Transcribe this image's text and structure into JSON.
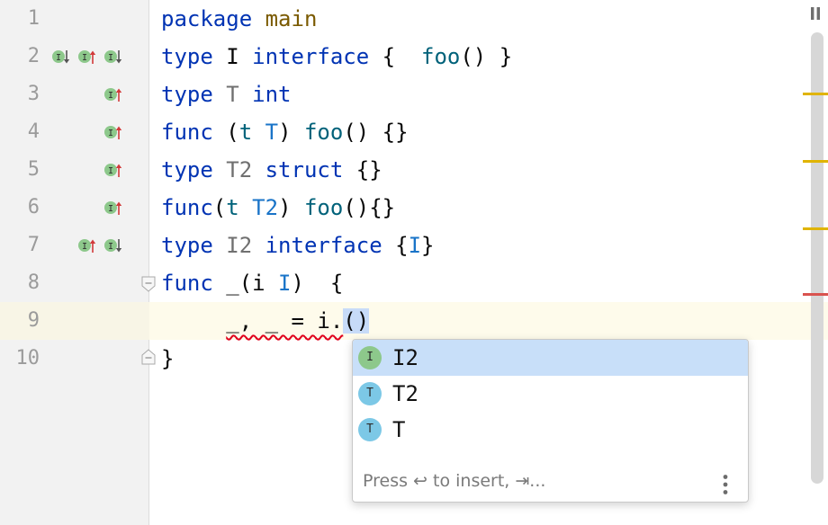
{
  "editor": {
    "line_numbers": [
      "1",
      "2",
      "3",
      "4",
      "5",
      "6",
      "7",
      "8",
      "9",
      "10"
    ],
    "lines": [
      {
        "tokens": [
          [
            "kw",
            "package"
          ],
          [
            "",
            " "
          ],
          [
            "pk",
            "main"
          ]
        ]
      },
      {
        "tokens": [
          [
            "kw",
            "type"
          ],
          [
            "",
            " I "
          ],
          [
            "kw",
            "interface"
          ],
          [
            "",
            " {  "
          ],
          [
            "fn",
            "foo"
          ],
          [
            "",
            "() }"
          ]
        ]
      },
      {
        "tokens": [
          [
            "kw",
            "type"
          ],
          [
            "",
            " "
          ],
          [
            "tp",
            "T"
          ],
          [
            "",
            " "
          ],
          [
            "kw",
            "int"
          ]
        ]
      },
      {
        "tokens": [
          [
            "kw",
            "func"
          ],
          [
            "",
            " ("
          ],
          [
            "pr",
            "t"
          ],
          [
            "",
            " "
          ],
          [
            "ti",
            "T"
          ],
          [
            "",
            ") "
          ],
          [
            "fn",
            "foo"
          ],
          [
            "",
            "() {}"
          ]
        ]
      },
      {
        "tokens": [
          [
            "kw",
            "type"
          ],
          [
            "",
            " "
          ],
          [
            "tp",
            "T2"
          ],
          [
            "",
            " "
          ],
          [
            "kw",
            "struct"
          ],
          [
            "",
            " {}"
          ]
        ]
      },
      {
        "tokens": [
          [
            "kw",
            "func"
          ],
          [
            "",
            "("
          ],
          [
            "pr",
            "t"
          ],
          [
            "",
            " "
          ],
          [
            "ti",
            "T2"
          ],
          [
            "",
            ") "
          ],
          [
            "fn",
            "foo"
          ],
          [
            "",
            "(){}"
          ]
        ]
      },
      {
        "tokens": [
          [
            "kw",
            "type"
          ],
          [
            "",
            " "
          ],
          [
            "tp",
            "I2"
          ],
          [
            "",
            " "
          ],
          [
            "kw",
            "interface"
          ],
          [
            "",
            " {"
          ],
          [
            "ti",
            "I"
          ],
          [
            "",
            "}"
          ]
        ]
      },
      {
        "tokens": [
          [
            "kw",
            "func"
          ],
          [
            "",
            " _(i "
          ],
          [
            "ti",
            "I"
          ],
          [
            "",
            ")  {"
          ]
        ]
      },
      {
        "tokens": [
          [
            "",
            "     "
          ],
          [
            "err",
            "_, _ = i."
          ],
          [
            "caretbox",
            "()"
          ]
        ]
      },
      {
        "tokens": [
          [
            "",
            "}"
          ]
        ]
      }
    ],
    "current_line": "9",
    "gutter_markers": {
      "2": [
        "implemented-down",
        "implementing-up",
        "implemented-down"
      ],
      "3": [
        "implementing-up"
      ],
      "4": [
        "implementing-up"
      ],
      "5": [
        "implementing-up"
      ],
      "6": [
        "implementing-up"
      ],
      "7": [
        "implementing-up",
        "implemented-down"
      ]
    },
    "marker_letter": "I"
  },
  "completion": {
    "items": [
      {
        "kind": "I",
        "label": "I2",
        "selected": true
      },
      {
        "kind": "T",
        "label": "T2",
        "selected": false
      },
      {
        "kind": "T",
        "label": "T",
        "selected": false
      }
    ],
    "hint": "Press ↩ to insert, ⇥..."
  },
  "colors": {
    "keyword": "#0033b3",
    "warning_stripe": "#e0b400",
    "error_stripe": "#d9534f",
    "selection": "#c8dff9"
  }
}
